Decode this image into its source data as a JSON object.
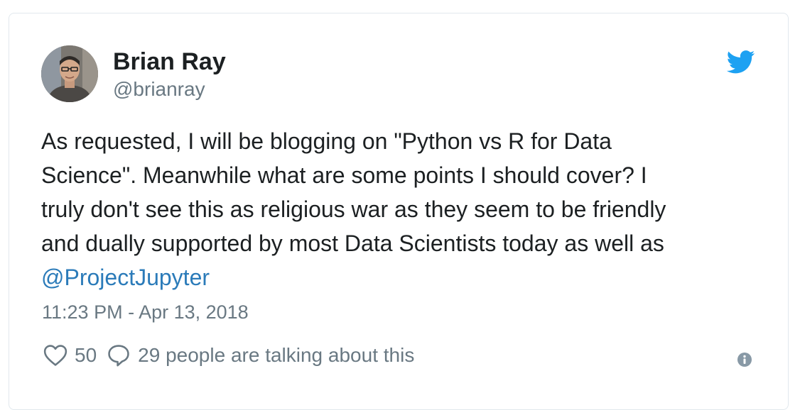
{
  "user": {
    "name": "Brian Ray",
    "handle": "@brianray",
    "avatar_icon": "profile-photo"
  },
  "brand": {
    "icon": "twitter-bird-icon",
    "color": "#1da1f2"
  },
  "tweet": {
    "lines": [
      "As requested, I will be blogging on \"Python vs R for Data",
      "Science\". Meanwhile what are some points I should cover? I",
      "truly don't see this as religious war as they seem to be friendly",
      "and dually supported by most Data Scientists today as well as"
    ],
    "mention": "@ProjectJupyter",
    "mention_color": "#2b7bb9",
    "timestamp": "11:23 PM - Apr 13, 2018"
  },
  "actions": {
    "like_icon": "heart-icon",
    "like_count": "50",
    "reply_icon": "speech-bubble-icon",
    "talking_label": "29 people are talking about this",
    "info_icon": "info-icon"
  }
}
